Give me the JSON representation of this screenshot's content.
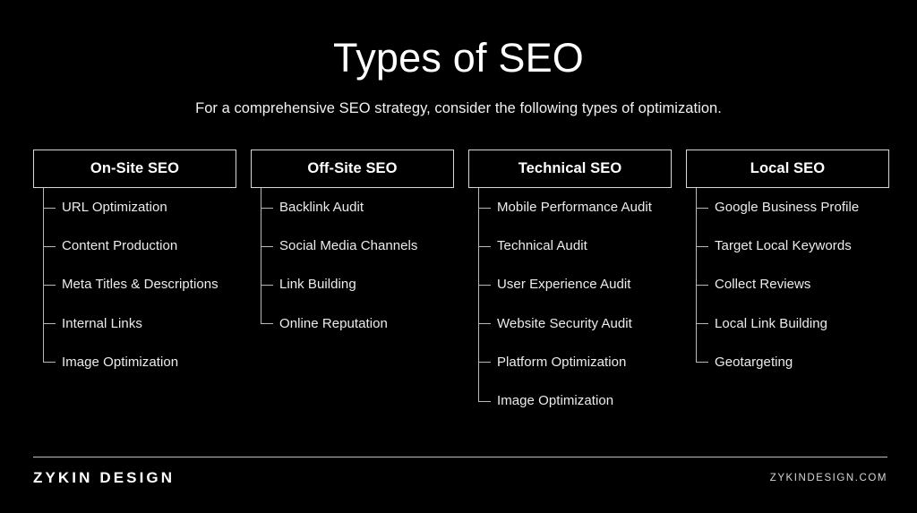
{
  "slide": {
    "background_color": "#000000",
    "text_color": "#ffffff",
    "line_color": "#b9b9b9"
  },
  "header": {
    "title": "Types of SEO",
    "subtitle": "For a comprehensive SEO strategy, consider the following types of optimization."
  },
  "columns": [
    {
      "header": "On-Site SEO",
      "items": [
        "URL Optimization",
        "Content Production",
        "Meta Titles & Descriptions",
        "Internal Links",
        "Image Optimization"
      ]
    },
    {
      "header": "Off-Site SEO",
      "items": [
        "Backlink Audit",
        "Social Media Channels",
        "Link Building",
        "Online Reputation"
      ]
    },
    {
      "header": "Technical SEO",
      "items": [
        "Mobile Performance Audit",
        "Technical Audit",
        "User Experience Audit",
        "Website Security Audit",
        "Platform Optimization",
        "Image Optimization"
      ]
    },
    {
      "header": "Local SEO",
      "items": [
        "Google Business Profile",
        "Target Local Keywords",
        "Collect Reviews",
        "Local Link Building",
        "Geotargeting"
      ]
    }
  ],
  "footer": {
    "brand": "ZYKIN DESIGN",
    "url": "ZYKINDESIGN.COM"
  }
}
